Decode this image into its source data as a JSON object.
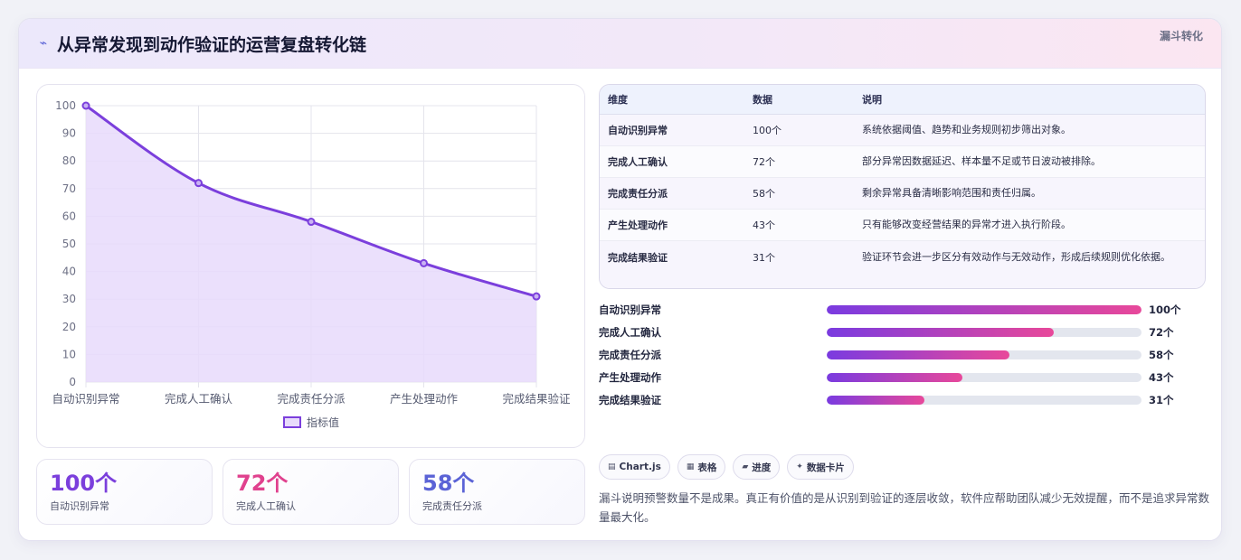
{
  "header": {
    "title": "从异常发现到动作验证的运营复盘转化链",
    "tag": "漏斗转化",
    "bolt_icon": "⌁"
  },
  "chart_data": {
    "type": "area",
    "categories": [
      "自动识别异常",
      "完成人工确认",
      "完成责任分派",
      "产生处理动作",
      "完成结果验证"
    ],
    "series": [
      {
        "name": "指标值",
        "values": [
          100,
          72,
          58,
          43,
          31
        ]
      }
    ],
    "title": "",
    "xlabel": "",
    "ylabel": "",
    "ylim": [
      0,
      100
    ],
    "yticks": [
      0,
      10,
      20,
      30,
      40,
      50,
      60,
      70,
      80,
      90,
      100
    ],
    "grid": true,
    "legend": "bottom",
    "line_color": "#7b3fdc",
    "fill_color": "#e8dbfb"
  },
  "kpis": [
    {
      "value": "100个",
      "label": "自动识别异常",
      "color": "#7b3fdc"
    },
    {
      "value": "72个",
      "label": "完成人工确认",
      "color": "#e0418e"
    },
    {
      "value": "58个",
      "label": "完成责任分派",
      "color": "#5b63d6"
    }
  ],
  "table": {
    "headers": [
      "维度",
      "数据",
      "说明"
    ],
    "rows": [
      {
        "dim": "自动识别异常",
        "value": "100个",
        "desc": "系统依据阈值、趋势和业务规则初步筛出对象。"
      },
      {
        "dim": "完成人工确认",
        "value": "72个",
        "desc": "部分异常因数据延迟、样本量不足或节日波动被排除。"
      },
      {
        "dim": "完成责任分派",
        "value": "58个",
        "desc": "剩余异常具备清晰影响范围和责任归属。"
      },
      {
        "dim": "产生处理动作",
        "value": "43个",
        "desc": "只有能够改变经营结果的异常才进入执行阶段。"
      },
      {
        "dim": "完成结果验证",
        "value": "31个",
        "desc": "验证环节会进一步区分有效动作与无效动作，形成后续规则优化依据。"
      }
    ]
  },
  "progress": [
    {
      "label": "自动识别异常",
      "value": "100个",
      "fraction": 1.0
    },
    {
      "label": "完成人工确认",
      "value": "72个",
      "fraction": 0.72
    },
    {
      "label": "完成责任分派",
      "value": "58个",
      "fraction": 0.58
    },
    {
      "label": "产生处理动作",
      "value": "43个",
      "fraction": 0.43
    },
    {
      "label": "完成结果验证",
      "value": "31个",
      "fraction": 0.31
    }
  ],
  "chips": [
    {
      "icon": "▤",
      "icon_name": "chart-icon",
      "label": "Chart.js"
    },
    {
      "icon": "▦",
      "icon_name": "table-icon",
      "label": "表格"
    },
    {
      "icon": "▰",
      "icon_name": "progress-icon",
      "label": "进度"
    },
    {
      "icon": "✦",
      "icon_name": "sparkle-icon",
      "label": "数据卡片"
    }
  ],
  "note": "漏斗说明预警数量不是成果。真正有价值的是从识别到验证的逐层收敛，软件应帮助团队减少无效提醒，而不是追求异常数量最大化。"
}
